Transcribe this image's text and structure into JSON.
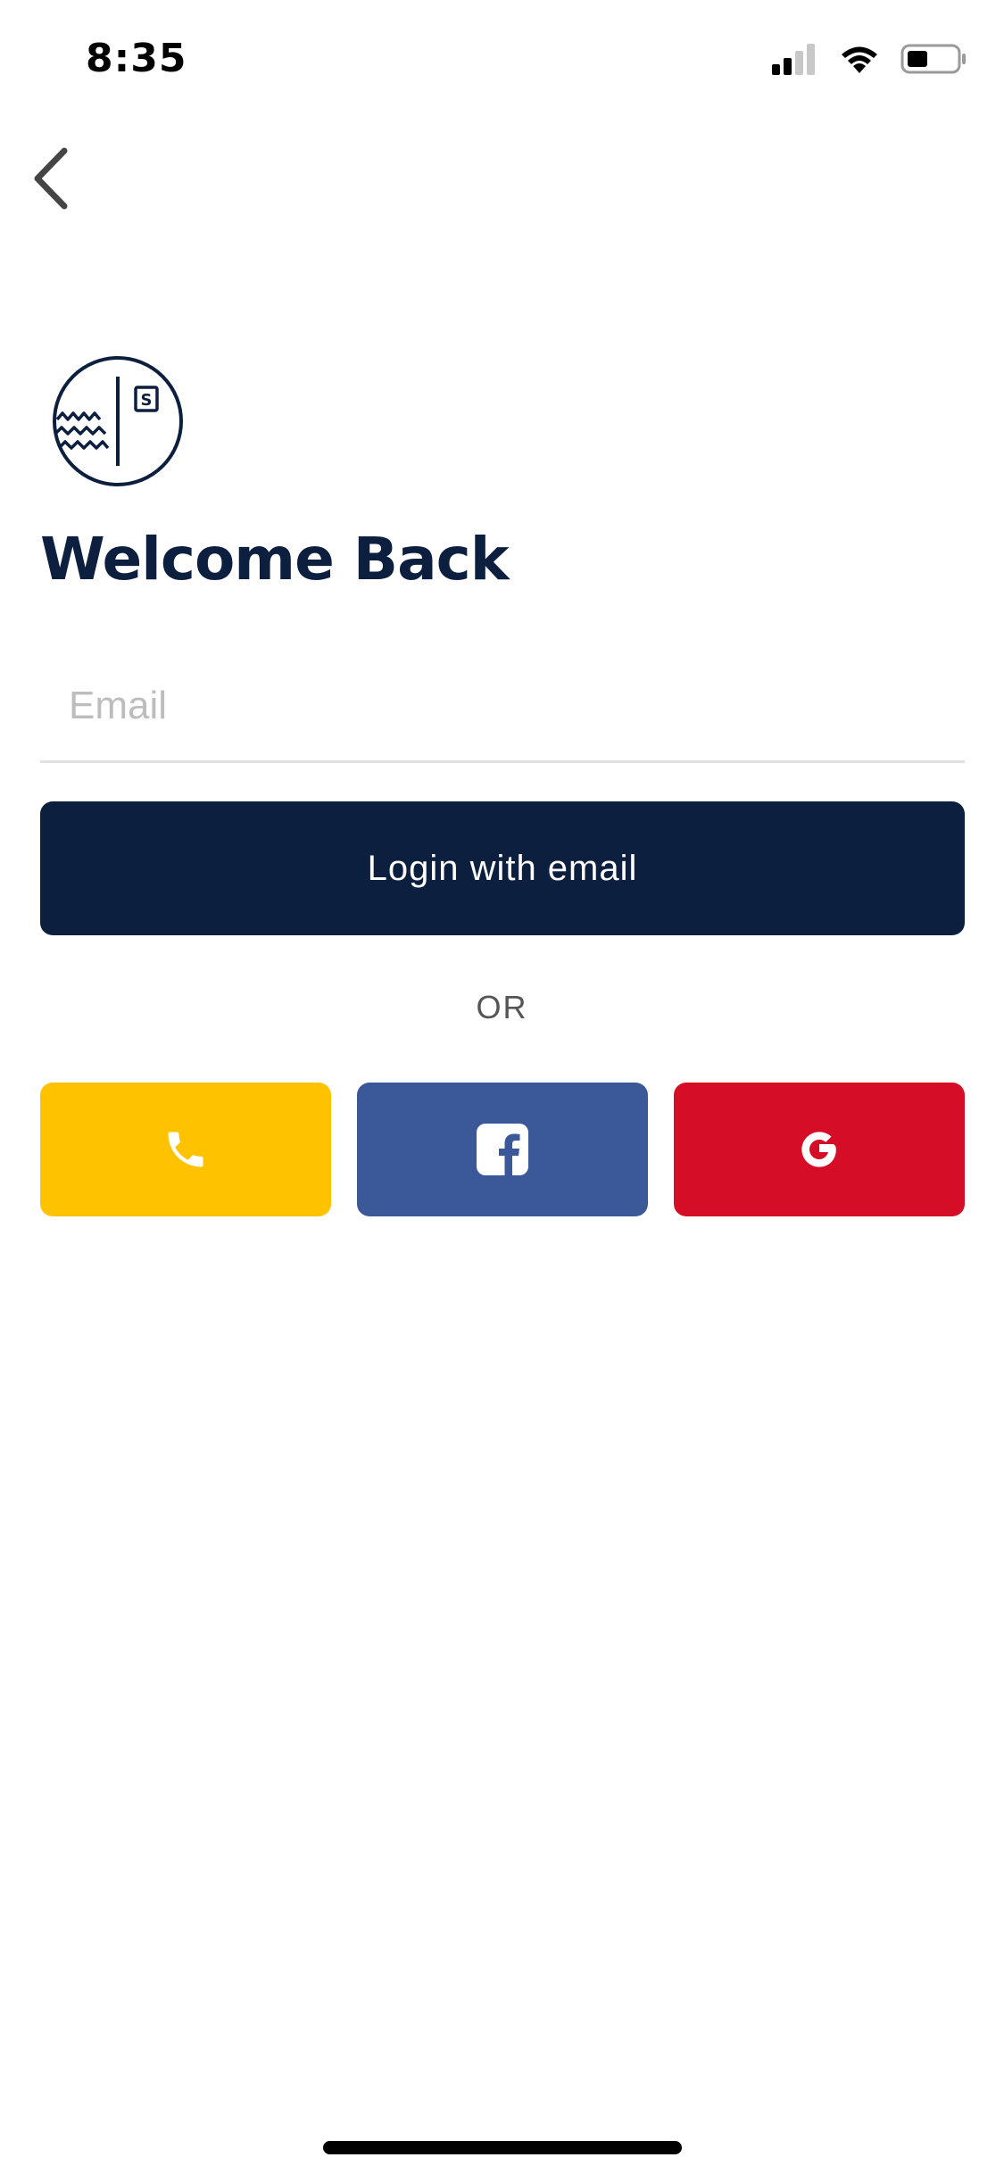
{
  "status_bar": {
    "time": "8:35"
  },
  "logo": {
    "badge_letter": "S"
  },
  "title": "Welcome Back",
  "email": {
    "placeholder": "Email",
    "value": ""
  },
  "login_button_label": "Login with email",
  "divider_text": "OR",
  "social": [
    {
      "name": "phone",
      "icon": "phone-icon",
      "color": "#ffc200"
    },
    {
      "name": "facebook",
      "icon": "facebook-icon",
      "color": "#3b5998"
    },
    {
      "name": "google",
      "icon": "google-icon",
      "color": "#d60d26"
    }
  ],
  "colors": {
    "primary": "#0c1f3f",
    "divider": "#e0e0e0"
  }
}
